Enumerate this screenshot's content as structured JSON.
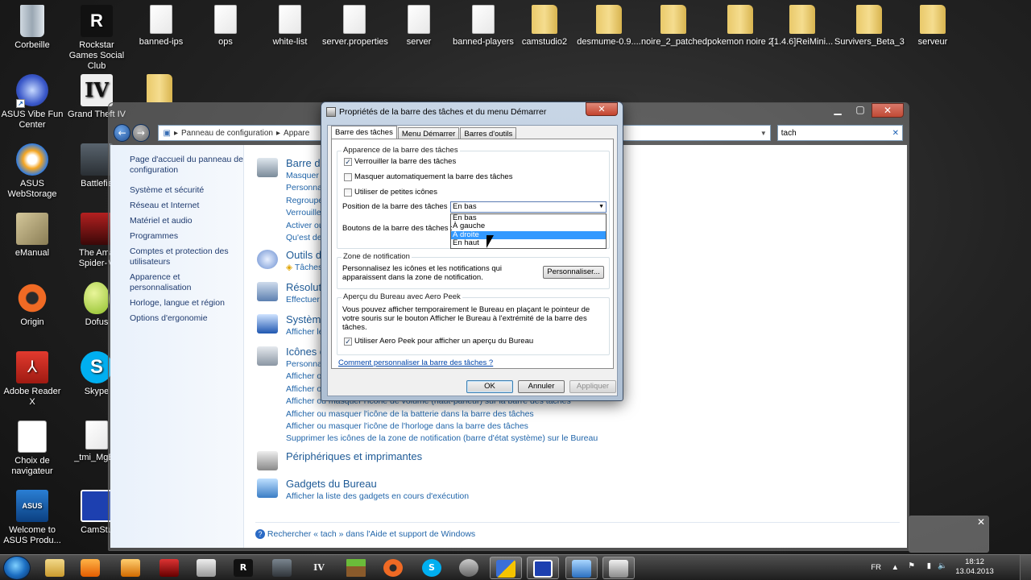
{
  "desktop_icons": [
    {
      "label": "Corbeille",
      "kind": "recycle"
    },
    {
      "label": "Rockstar Games Social Club",
      "kind": "rockstar"
    },
    {
      "label": "banned-ips",
      "kind": "file"
    },
    {
      "label": "ops",
      "kind": "file"
    },
    {
      "label": "white-list",
      "kind": "file"
    },
    {
      "label": "server.properties",
      "kind": "file"
    },
    {
      "label": "server",
      "kind": "file"
    },
    {
      "label": "banned-players",
      "kind": "file"
    },
    {
      "label": "camstudio2",
      "kind": "folder"
    },
    {
      "label": "desmume-0.9....",
      "kind": "folder"
    },
    {
      "label": "noire_2_patched",
      "kind": "folder"
    },
    {
      "label": "pokemon noire 2",
      "kind": "folder"
    },
    {
      "label": "[1.4.6]ReiMini...",
      "kind": "folder"
    },
    {
      "label": "Survivers_Beta_3",
      "kind": "folder"
    },
    {
      "label": "serveur",
      "kind": "folder"
    },
    {
      "label": "ASUS  Vibe Fun Center",
      "kind": "app"
    },
    {
      "label": "Grand Theft IV",
      "kind": "app"
    },
    {
      "label": "ASUS WebStorage",
      "kind": "app"
    },
    {
      "label": "Battlefie",
      "kind": "app"
    },
    {
      "label": "eManual",
      "kind": "app"
    },
    {
      "label": "The Ama Spider-M",
      "kind": "app"
    },
    {
      "label": "Origin",
      "kind": "app"
    },
    {
      "label": "Dofus",
      "kind": "app"
    },
    {
      "label": "Adobe Reader X",
      "kind": "app"
    },
    {
      "label": "Skype",
      "kind": "app"
    },
    {
      "label": "Choix de navigateur",
      "kind": "app"
    },
    {
      "label": "_tmi_MgBu",
      "kind": "file"
    },
    {
      "label": "Welcome to ASUS Produ...",
      "kind": "app"
    },
    {
      "label": "CamStu",
      "kind": "app"
    }
  ],
  "control_panel": {
    "breadcrumb_1": "Panneau de configuration",
    "breadcrumb_2": "Appare",
    "search_value": "tach",
    "left_nav": [
      "Page d'accueil du panneau de configuration",
      "Système et sécurité",
      "Réseau et Internet",
      "Matériel et audio",
      "Programmes",
      "Comptes et protection des utilisateurs",
      "Apparence et personnalisation",
      "Horloge, langue et région",
      "Options d'ergonomie"
    ],
    "categories": [
      {
        "title": "Barre d",
        "links": [
          "Masquer a",
          "Personnal",
          "Regroupe",
          "Verrouille",
          "Activer ou",
          "Qu'est de"
        ]
      },
      {
        "title": "Outils d",
        "links": [
          "Tâches"
        ]
      },
      {
        "title": "Résolut",
        "links": [
          "Effectuer"
        ]
      },
      {
        "title": "Systèm",
        "links": [
          "Afficher le"
        ]
      },
      {
        "title": "Icônes d",
        "links": [
          "Personnal",
          "Afficher o",
          "Afficher o",
          "Afficher ou masquer l'icône de volume (haut-parleur) sur la barre des tâches",
          "Afficher ou masquer l'icône de la batterie dans la barre des tâches",
          "Afficher ou masquer l'icône de l'horloge dans la barre des tâches",
          "Supprimer les icônes de la zone de notification (barre d'état système) sur le Bureau"
        ]
      },
      {
        "title": "Périphériques et imprimantes",
        "links": []
      },
      {
        "title": "Gadgets du Bureau",
        "links": [
          "Afficher la liste des gadgets en cours d'exécution"
        ]
      }
    ],
    "footer_link": "Rechercher « tach » dans l'Aide et support de Windows"
  },
  "dialog": {
    "title": "Propriétés de la barre des tâches et du menu Démarrer",
    "tabs": [
      "Barre des tâches",
      "Menu Démarrer",
      "Barres d'outils"
    ],
    "group_appearance": "Apparence de la barre des tâches",
    "chk_lock": "Verrouiller la barre des tâches",
    "chk_autohide": "Masquer automatiquement la barre des tâches",
    "chk_small_icons": "Utiliser de petites icônes",
    "position_label": "Position de la barre des tâches :",
    "position_value": "En bas",
    "position_options": [
      "En bas",
      "À gauche",
      "À droite",
      "En haut"
    ],
    "buttons_label": "Boutons de la barre des tâches :",
    "group_notification": "Zone de notification",
    "notification_text": "Personnalisez les icônes et les notifications qui apparaissent dans la zone de notification.",
    "customize_button": "Personnaliser...",
    "group_aero": "Aperçu du Bureau avec Aero Peek",
    "aero_text": "Vous pouvez afficher temporairement le Bureau en plaçant le pointeur de votre souris sur le bouton Afficher le Bureau à l'extrémité de la barre des tâches.",
    "chk_aero": "Utiliser Aero Peek pour afficher un aperçu du Bureau",
    "help_link": "Comment personnaliser la barre des tâches ?",
    "ok": "OK",
    "cancel": "Annuler",
    "apply": "Appliquer"
  },
  "taskbar": {
    "lang": "FR",
    "time": "18:12",
    "date": "13.04.2013"
  },
  "colors": {
    "selection": "#3399ff",
    "link": "#2266aa",
    "title_blue": "#1e5a96"
  }
}
